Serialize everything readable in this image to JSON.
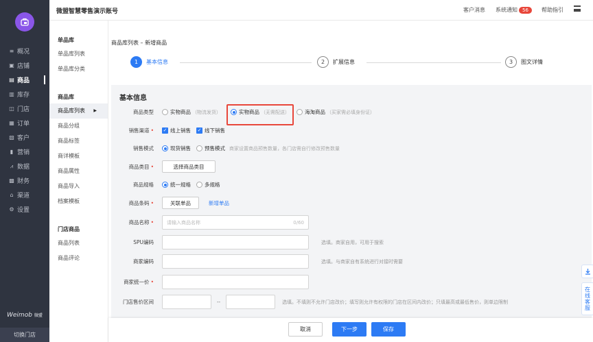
{
  "header": {
    "title": "微盟智慧零售演示账号",
    "msg": "客户消息",
    "notice": "系统通知",
    "notice_count": "56",
    "help": "帮助指引"
  },
  "sidebar": {
    "items": [
      {
        "icon": "≡",
        "label": "概况"
      },
      {
        "icon": "▣",
        "label": "店铺"
      },
      {
        "icon": "▤",
        "label": "商品"
      },
      {
        "icon": "▥",
        "label": "库存"
      },
      {
        "icon": "◫",
        "label": "门店"
      },
      {
        "icon": "▦",
        "label": "订单"
      },
      {
        "icon": "▧",
        "label": "客户"
      },
      {
        "icon": "▮",
        "label": "营销"
      },
      {
        "icon": "⩘",
        "label": "数据"
      },
      {
        "icon": "▩",
        "label": "财务"
      },
      {
        "icon": "⌂",
        "label": "渠道"
      },
      {
        "icon": "⚙",
        "label": "设置"
      }
    ],
    "brand": "Weimob",
    "brand_sub": "微盟",
    "switch": "切换门店"
  },
  "subnav": {
    "s1": "单品库",
    "s1_items": [
      "单品库列表",
      "单品库分类"
    ],
    "s2": "商品库",
    "s2_items": [
      "商品库列表",
      "商品分组",
      "商品标签",
      "商详模板",
      "商品属性",
      "商品导入",
      "档案模板"
    ],
    "s3": "门店商品",
    "s3_items": [
      "商品列表",
      "商品评论"
    ]
  },
  "crumb": "商品库列表 – 新增商品",
  "steps": [
    {
      "n": "1",
      "label": "基本信息"
    },
    {
      "n": "2",
      "label": "扩展信息"
    },
    {
      "n": "3",
      "label": "图文详情"
    }
  ],
  "form": {
    "title": "基本信息",
    "type_label": "商品类型",
    "type_opts": [
      "实物商品",
      "实物商品",
      "海淘商品"
    ],
    "type_hints": [
      "（物流发货）",
      "（无需配送）",
      "（买家需必填身份证）"
    ],
    "channel_label": "销售渠道",
    "channel_opts": [
      "线上销售",
      "线下销售"
    ],
    "mode_label": "销售模式",
    "mode_opts": [
      "现货销售",
      "预售模式"
    ],
    "mode_hint": "商家设置商品预售数量，各门店需自行修改预售数量",
    "cat_label": "商品类目",
    "cat_btn": "选择商品类目",
    "spec_label": "商品规格",
    "spec_opts": [
      "统一规格",
      "多规格"
    ],
    "code_label": "商品条码",
    "code_btn": "关联单品",
    "code_link": "新增单品",
    "name_label": "商品名称",
    "name_ph": "请输入商品名称",
    "name_cnt": "0/60",
    "spu_label": "SPU编码",
    "spu_note": "选填。商家自用，可用于搜索",
    "mc_label": "商家编码",
    "mc_note": "选填。与商家自有系统进行对接时需要",
    "price_label": "商家统一价",
    "range_label": "门店售价区间",
    "range_sep": "--",
    "range_note": "选填。不填则不允许门店改价；填写则允许有权限的门店在区间内改价；只填最高或最低售价，则单边限制"
  },
  "footer": {
    "cancel": "取消",
    "next": "下一步",
    "save": "保存"
  },
  "float": {
    "cs": "在线客服"
  }
}
